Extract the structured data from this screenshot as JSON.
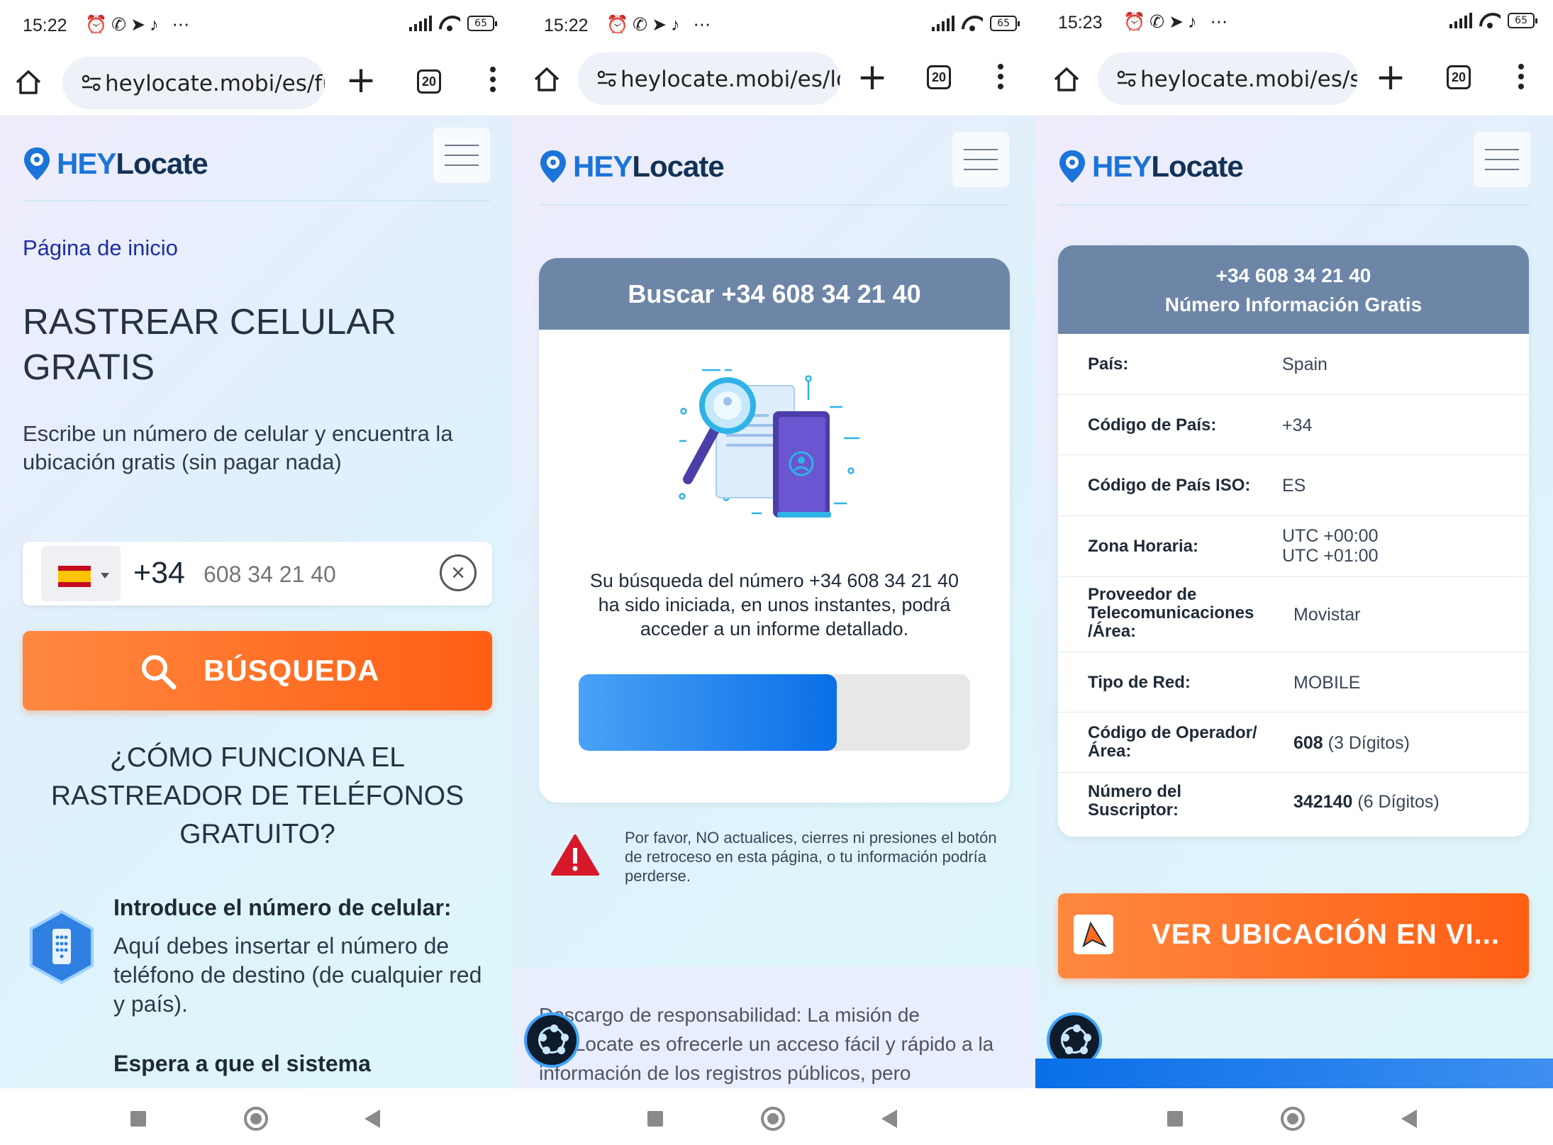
{
  "status": {
    "p1_time": "15:22",
    "p2_time": "15:22",
    "p3_time": "15:23",
    "battery": "65",
    "icons": [
      "alarm-icon",
      "whatsapp-icon",
      "telegram-icon",
      "tiktok-icon",
      "more-dots"
    ]
  },
  "browser": {
    "p1_url": "heylocate.mobi/es/fre",
    "p2_url": "heylocate.mobi/es/loa",
    "p3_url": "heylocate.mobi/es/se",
    "tab_count": "20"
  },
  "brand": {
    "logo_hey": "HEY",
    "logo_locate": "Locate"
  },
  "panel1": {
    "breadcrumb": "Página de inicio",
    "title_line1": "RASTREAR CELULAR",
    "title_line2": "GRATIS",
    "lead": "Escribe un número de celular y encuentra la ubicación gratis (sin pagar nada)",
    "dial_code": "+34",
    "phone_placeholder": "608 34 21 40",
    "search_label": "BÚSQUEDA",
    "how_title": "¿CÓMO FUNCIONA EL RASTREADOR DE TELÉFONOS GRATUITO?",
    "step1_title": "Introduce el número de celular:",
    "step1_desc": "Aquí debes insertar el número de teléfono de destino (de cualquier red y país).",
    "step2_title": "Espera a que el sistema"
  },
  "panel2": {
    "card_title": "Buscar +34 608 34 21 40",
    "message": "Su búsqueda del número +34 608 34 21 40 ha sido iniciada, en unos instantes, podrá acceder a un informe detallado.",
    "progress_fraction": 0.66,
    "warning": "Por favor, NO actualices, cierres ni presiones el botón de retroceso en esta página, o tu información podría perderse.",
    "disclaimer": "Descargo de responsabilidad: La misión de HeyLocate es ofrecerle un acceso fácil y rápido a la información de los registros públicos, pero"
  },
  "panel3": {
    "head_line1": "+34 608 34 21 40",
    "head_line2": "Número Información Gratis",
    "rows": [
      {
        "k": "País:",
        "v": "Spain"
      },
      {
        "k": "Código de País:",
        "v": "+34"
      },
      {
        "k": "Código de País ISO:",
        "v": "ES"
      },
      {
        "k": "Zona Horaria:",
        "v1": "UTC +00:00",
        "v2": "UTC +01:00"
      },
      {
        "k1": "Proveedor de",
        "k2": "Telecomunicaciones",
        "k3": "/Área:",
        "v": "Movistar"
      },
      {
        "k": "Tipo de Red:",
        "v": "MOBILE"
      },
      {
        "k1": "Código de Operador/",
        "k2": "Área:",
        "vb": "608",
        "v": " (3 Dígitos)"
      },
      {
        "k1": "Número del",
        "k2": "Suscriptor:",
        "vb": "342140",
        "v": " (6 Dígitos)"
      }
    ],
    "cta_label": "VER UBICACIÓN EN VI..."
  },
  "colors": {
    "brand_blue": "#1b74d9",
    "orange": "#ff6a1f",
    "card_header": "#6d86a8",
    "warning_red": "#d7182a"
  }
}
